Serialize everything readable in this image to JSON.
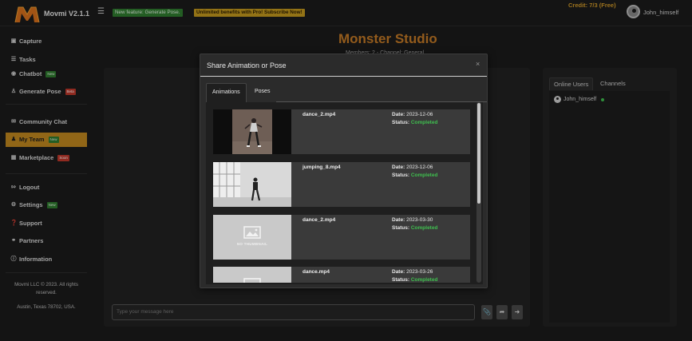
{
  "app": {
    "logo_label": "Movmi V2.1.1",
    "banner_feature": "New feature: Generate Pose.",
    "banner_subscribe": "Unlimited benefits with Pro! Subscribe Now!",
    "credit": "Credit: 7/3 (Free)",
    "user": "John_himself"
  },
  "sidebar": {
    "items": [
      {
        "label": "Capture",
        "icon": "camera-icon"
      },
      {
        "label": "Tasks",
        "icon": "list-icon"
      },
      {
        "label": "Chatbot",
        "icon": "robot-icon",
        "badge": "New"
      },
      {
        "label": "Generate Pose",
        "icon": "figure-icon",
        "badge": "Beta"
      },
      {
        "label": "Community Chat",
        "icon": "chat-icon"
      },
      {
        "label": "My Team",
        "icon": "team-icon",
        "badge": "New",
        "active": true
      },
      {
        "label": "Marketplace",
        "icon": "cart-icon",
        "badge": "Soon"
      },
      {
        "label": "Logout",
        "icon": "logout-icon"
      },
      {
        "label": "Settings",
        "icon": "gear-icon",
        "badge": "New"
      },
      {
        "label": "Support",
        "icon": "question-icon"
      },
      {
        "label": "Partners",
        "icon": "handshake-icon"
      },
      {
        "label": "Information",
        "icon": "info-icon"
      }
    ],
    "footer_line1": "Movmi LLC © 2023. All rights",
    "footer_line2": "reserved.",
    "footer_line3": "Austin, Texas 78702, USA."
  },
  "main": {
    "title": "Monster Studio",
    "subtitle": "Members: 2   -   Channel: General",
    "chat_placeholder": "Type your message here"
  },
  "right_panel": {
    "tabs": [
      "Online Users",
      "Channels"
    ],
    "online_users": [
      "John_himself"
    ]
  },
  "modal": {
    "title": "Share Animation or Pose",
    "close": "×",
    "tabs": [
      "Animations",
      "Poses"
    ],
    "date_label": "Date:",
    "status_label": "Status:",
    "no_thumbnail_text": "NO THUMBNAIL",
    "items": [
      {
        "name": "dance_2.mp4",
        "date": "2023-12-06",
        "status": "Completed"
      },
      {
        "name": "jumping_8.mp4",
        "date": "2023-12-06",
        "status": "Completed"
      },
      {
        "name": "dance_2.mp4",
        "date": "2023-03-30",
        "status": "Completed"
      },
      {
        "name": "dance.mp4",
        "date": "2023-03-26",
        "status": "Completed"
      }
    ]
  },
  "colors": {
    "accent": "#c2891f",
    "title_orange": "#c47a26",
    "success": "#3fbf4f"
  }
}
